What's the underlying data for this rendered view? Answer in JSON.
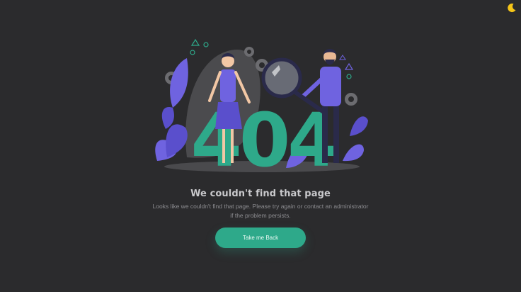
{
  "error_page": {
    "title": "We couldn't find that page",
    "description_line1": "Looks like we couldn't find that page. Please try again or contact an administrator",
    "description_line2": "if the problem persists.",
    "back_button_label": "Take me Back",
    "illustration_text": "404"
  },
  "theme_toggle": {
    "icon": "moon-icon",
    "color": "#f5c518"
  },
  "colors": {
    "background": "#2b2b2d",
    "accent": "#2ea98a",
    "illustration_purple": "#6f63e0",
    "title_text": "#c9c9cc",
    "body_text": "#8c8c90"
  }
}
